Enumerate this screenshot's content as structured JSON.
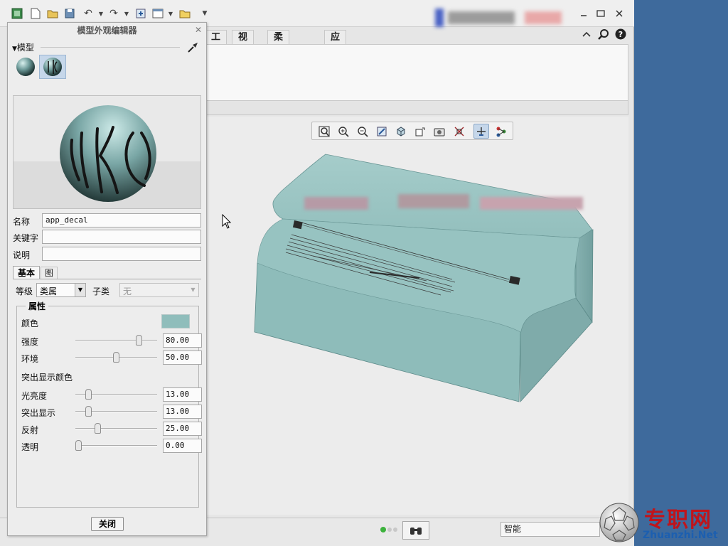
{
  "app": {
    "tabs": [
      {
        "label": "工具"
      },
      {
        "label": "视图"
      },
      {
        "label": "柔性建模"
      },
      {
        "label": "应用程序"
      }
    ],
    "status": {
      "filter_value": "智能"
    }
  },
  "dialog": {
    "title": "模型外观编辑器",
    "model_section_label": "模型",
    "fields": {
      "name_label": "名称",
      "name_value": "app_decal",
      "keyword_label": "关键字",
      "keyword_value": "",
      "description_label": "说明",
      "description_value": ""
    },
    "tabs": [
      {
        "label": "基本"
      },
      {
        "label": "图"
      }
    ],
    "class_label": "等级",
    "class_value": "类属",
    "subclass_label": "子类",
    "subclass_value": "无",
    "properties_title": "属性",
    "color_label": "颜色",
    "color_value": "#8fbdbb",
    "sliders_main": [
      {
        "label": "强度",
        "value": "80.00",
        "level": 0.8
      },
      {
        "label": "环境",
        "value": "50.00",
        "level": 0.5
      }
    ],
    "highlight_title": "突出显示颜色",
    "sliders_highlight": [
      {
        "label": "光亮度",
        "value": "13.00",
        "level": 0.13
      },
      {
        "label": "突出显示",
        "value": "13.00",
        "level": 0.13
      },
      {
        "label": "反射",
        "value": "25.00",
        "level": 0.25
      },
      {
        "label": "透明",
        "value": "0.00",
        "level": 0.0
      }
    ],
    "close_label": "关闭"
  },
  "watermark": {
    "text_cn": "专职网",
    "text_en": "Zhuanzhi.Net"
  },
  "colors": {
    "model": "#8fbdbb",
    "desktop": "#3e6a9c",
    "watermark_red": "#c0141b"
  }
}
